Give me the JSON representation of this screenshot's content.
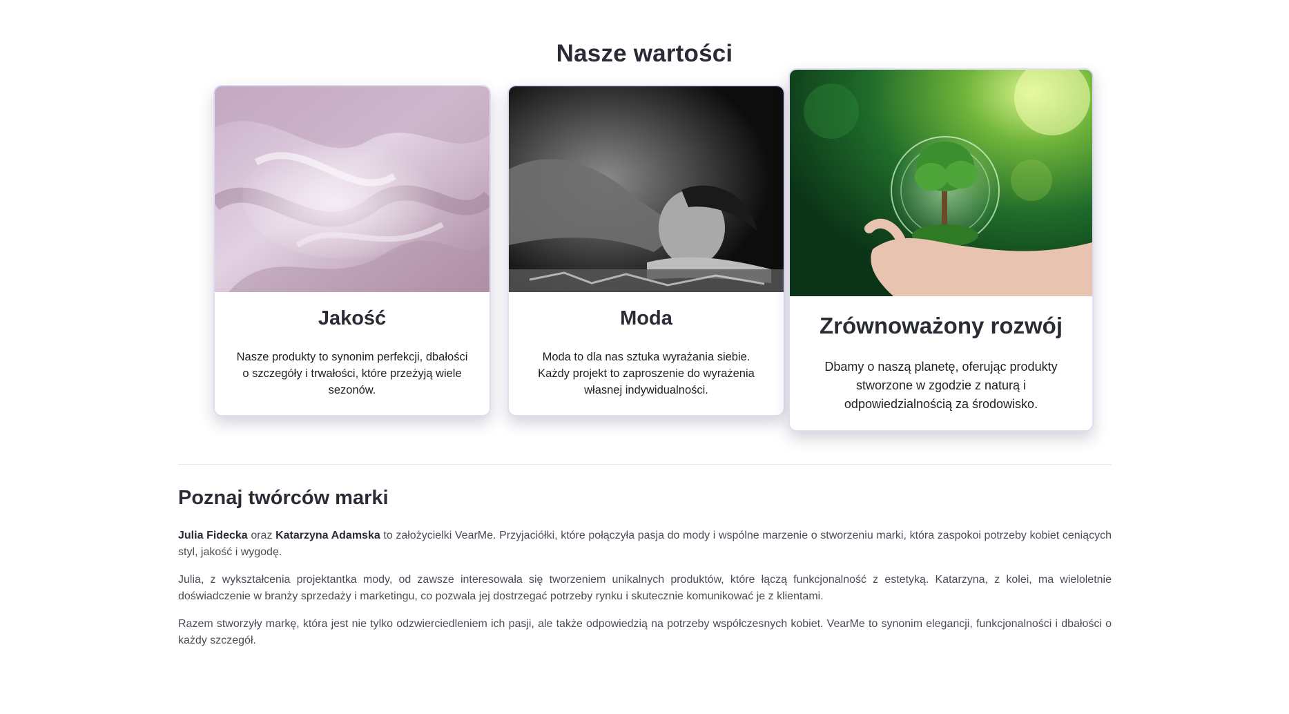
{
  "values_section": {
    "title": "Nasze wartości",
    "cards": [
      {
        "image_alt": "lilac-silk-fabric",
        "title": "Jakość",
        "text": "Nasze produkty to synonim perfekcji, dbałości o szczegóły i trwałości, które przeżyją wiele sezonów."
      },
      {
        "image_alt": "black-and-white-portrait",
        "title": "Moda",
        "text": "Moda to dla nas sztuka wyrażania siebie. Każdy projekt to zaproszenie do wyrażenia własnej indywidualności."
      },
      {
        "image_alt": "tree-in-hand",
        "title": "Zrównoważony rozwój",
        "text": "Dbamy o naszą planetę, oferując produkty stworzone w zgodzie z naturą i odpowiedzialnością za środowisko."
      }
    ]
  },
  "founders_section": {
    "title": "Poznaj twórców marki",
    "p1_name1": "Julia Fidecka",
    "p1_conj": " oraz ",
    "p1_name2": "Katarzyna Adamska",
    "p1_rest": " to założycielki VearMe. Przyjaciółki, które połączyła pasja do mody i wspólne marzenie o stworzeniu marki, która zaspokoi potrzeby kobiet ceniących styl, jakość i wygodę.",
    "p2": "Julia, z wykształcenia projektantka mody, od zawsze interesowała się tworzeniem unikalnych produktów, które łączą funkcjonalność z estetyką. Katarzyna, z kolei, ma wieloletnie doświadczenie w branży sprzedaży i marketingu, co pozwala jej dostrzegać potrzeby rynku i skutecznie komunikować je z klientami.",
    "p3": "Razem stworzyły markę, która jest nie tylko odzwierciedleniem ich pasji, ale także odpowiedzią na potrzeby współczesnych kobiet. VearMe to synonim elegancji, funkcjonalności i dbałości o każdy szczegół."
  }
}
